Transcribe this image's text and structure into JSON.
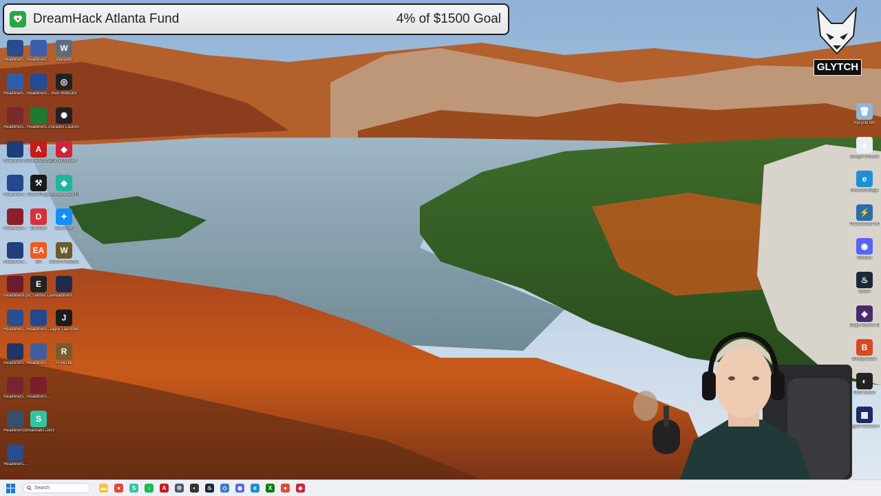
{
  "banner": {
    "title": "DreamHack Atlanta Fund",
    "goal": "4% of $1500 Goal",
    "progress_percent": 4,
    "accent": "#27a844"
  },
  "brand": {
    "logo_text": "GLYTCH"
  },
  "desktop": {
    "col1": [
      {
        "label": "Headliners...",
        "color": "#2b4c8c",
        "glyph": ""
      },
      {
        "label": "Headliners...",
        "color": "#2f5ea8",
        "glyph": ""
      },
      {
        "label": "Headliners...",
        "color": "#7a2a2a",
        "glyph": ""
      },
      {
        "label": "Headliners...",
        "color": "#1d3d7a",
        "glyph": ""
      },
      {
        "label": "Headliners...",
        "color": "#24478e",
        "glyph": ""
      },
      {
        "label": "Headliners...",
        "color": "#8c1f2a",
        "glyph": ""
      },
      {
        "label": "Headliners...",
        "color": "#233e7c",
        "glyph": ""
      },
      {
        "label": "Headliners...",
        "color": "#6a1c2c",
        "glyph": ""
      },
      {
        "label": "Headliners...",
        "color": "#2a4f90",
        "glyph": ""
      },
      {
        "label": "Headliners...",
        "color": "#1f3565",
        "glyph": ""
      },
      {
        "label": "Headliners...",
        "color": "#7b2232",
        "glyph": ""
      },
      {
        "label": "Headliners...",
        "color": "#36506e",
        "glyph": ""
      },
      {
        "label": "Headliners...",
        "color": "#2b4c8c",
        "glyph": ""
      }
    ],
    "col2": [
      {
        "label": "Headliners...",
        "color": "#3a5fae",
        "glyph": ""
      },
      {
        "label": "Headliners...",
        "color": "#244a8f",
        "glyph": ""
      },
      {
        "label": "Headliners...",
        "color": "#1d7a2f",
        "glyph": ""
      },
      {
        "label": "Adobe Acrobat",
        "color": "#c61b1b",
        "glyph": "A"
      },
      {
        "label": "CurseForge",
        "color": "#1a1a1a",
        "glyph": "⚒"
      },
      {
        "label": "DouWan",
        "color": "#d8313d",
        "glyph": "D"
      },
      {
        "label": "EA",
        "color": "#f05a22",
        "glyph": "EA"
      },
      {
        "label": "Epic Games Launcher",
        "color": "#222222",
        "glyph": "E"
      },
      {
        "label": "Headliners...",
        "color": "#24478e",
        "glyph": ""
      },
      {
        "label": "Headliners...",
        "color": "#3e5ea0",
        "glyph": ""
      },
      {
        "label": "Headliners...",
        "color": "#7a1f2a",
        "glyph": ""
      },
      {
        "label": "Streamlabs Desktop",
        "color": "#31c3a2",
        "glyph": "S"
      }
    ],
    "col3": [
      {
        "label": "Warpath",
        "color": "#5d6b7a",
        "glyph": "W"
      },
      {
        "label": "Iriun Webcam",
        "color": "#222222",
        "glyph": "◎"
      },
      {
        "label": "Paradox Launcher v2",
        "color": "#222222",
        "glyph": "✺"
      },
      {
        "label": "Lumia Stream",
        "color": "#d0243c",
        "glyph": "◆"
      },
      {
        "label": "Wondershare Filmora 14",
        "color": "#1fb5a0",
        "glyph": "◆"
      },
      {
        "label": "Battle.net",
        "color": "#148eff",
        "glyph": "✦"
      },
      {
        "label": "World of Warcraft",
        "color": "#6b5a2e",
        "glyph": "W"
      },
      {
        "label": "Headliners...",
        "color": "#1e2b4a",
        "glyph": ""
      },
      {
        "label": "Jagex Launcher",
        "color": "#1c1c1c",
        "glyph": "J"
      },
      {
        "label": "RuneLite",
        "color": "#7a5a2a",
        "glyph": "R"
      }
    ],
    "right": [
      {
        "label": "Recycle Bin",
        "color": "#8fb6d8",
        "glyph": "🗑"
      },
      {
        "label": "Google Chrome",
        "color": "#e8eef2",
        "glyph": "●"
      },
      {
        "label": "Microsoft Edge",
        "color": "#1f8fd6",
        "glyph": "e"
      },
      {
        "label": "Thunderstore Mod Manager",
        "color": "#2b6ea8",
        "glyph": "⚡"
      },
      {
        "label": "Discord",
        "color": "#5865f2",
        "glyph": "◉"
      },
      {
        "label": "Steam",
        "color": "#1b2838",
        "glyph": "♨"
      },
      {
        "label": "Origin Games Shortcut",
        "color": "#4a2a6b",
        "glyph": "◈"
      },
      {
        "label": "Bitwig Studio",
        "color": "#d64a1f",
        "glyph": "B"
      },
      {
        "label": "OBS Studio",
        "color": "#222222",
        "glyph": "◐"
      },
      {
        "label": "Elgato Camera Hub",
        "color": "#1a2a6b",
        "glyph": "▦"
      }
    ]
  },
  "taskbar": {
    "search_placeholder": "Search",
    "apps": [
      {
        "name": "file-explorer",
        "color": "#f4c542",
        "glyph": "▬"
      },
      {
        "name": "chrome",
        "color": "#e04a3a",
        "glyph": "●"
      },
      {
        "name": "streamlabs",
        "color": "#31c3a2",
        "glyph": "S"
      },
      {
        "name": "spotify",
        "color": "#1db954",
        "glyph": "♪"
      },
      {
        "name": "acrobat",
        "color": "#c61b1b",
        "glyph": "A"
      },
      {
        "name": "settings",
        "color": "#4a5a6a",
        "glyph": "⚙"
      },
      {
        "name": "obs",
        "color": "#333333",
        "glyph": "◐"
      },
      {
        "name": "steam",
        "color": "#1b2838",
        "glyph": "♨"
      },
      {
        "name": "davinci",
        "color": "#3a7bd5",
        "glyph": "◇"
      },
      {
        "name": "discord",
        "color": "#5865f2",
        "glyph": "◉"
      },
      {
        "name": "edge",
        "color": "#1f8fd6",
        "glyph": "e"
      },
      {
        "name": "xbox",
        "color": "#107c10",
        "glyph": "X"
      },
      {
        "name": "chrome-2",
        "color": "#e04a3a",
        "glyph": "●"
      },
      {
        "name": "lumia",
        "color": "#d0243c",
        "glyph": "◆"
      }
    ],
    "clock": ""
  }
}
